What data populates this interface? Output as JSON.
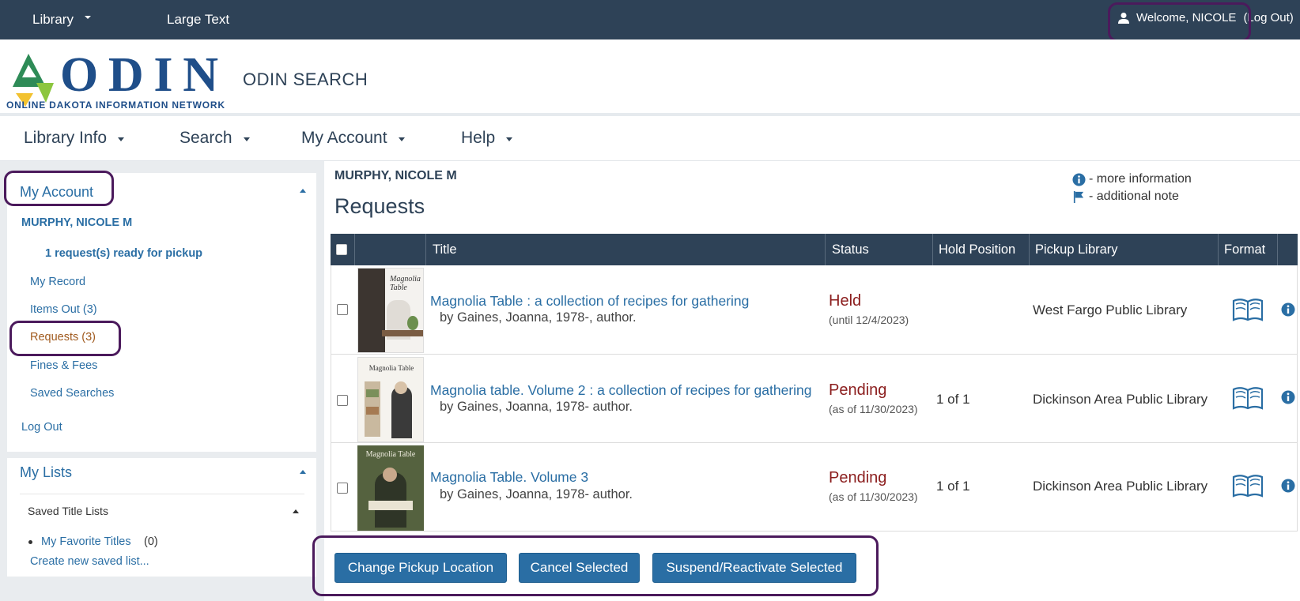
{
  "topbar": {
    "library_label": "Library",
    "large_text_label": "Large Text",
    "welcome_text": "Welcome, NICOLE",
    "logout_text": "(Log Out)"
  },
  "header": {
    "logo_text": "ODIN",
    "logo_subtitle": "ONLINE DAKOTA INFORMATION NETWORK",
    "site_title": "ODIN SEARCH"
  },
  "mainnav": {
    "items": [
      {
        "label": "Library Info"
      },
      {
        "label": "Search"
      },
      {
        "label": "My Account"
      },
      {
        "label": "Help"
      }
    ]
  },
  "sidebar": {
    "account_heading": "My Account",
    "patron_name": "MURPHY, NICOLE M",
    "pickup_notice": "1 request(s) ready for pickup",
    "links": [
      {
        "label": "My Record"
      },
      {
        "label": "Items Out (3)"
      },
      {
        "label": "Requests (3)"
      },
      {
        "label": "Fines & Fees"
      },
      {
        "label": "Saved Searches"
      }
    ],
    "logout_label": "Log Out",
    "lists_heading": "My Lists",
    "saved_title_lists_label": "Saved Title Lists",
    "favorite_list_label": "My Favorite Titles",
    "favorite_list_count": "(0)",
    "create_list_label": "Create new saved list..."
  },
  "content": {
    "patron_name": "MURPHY, NICOLE M",
    "page_title": "Requests",
    "legend_info": "- more information",
    "legend_note": "- additional note"
  },
  "table": {
    "headers": [
      "Title",
      "Status",
      "Hold Position",
      "Pickup Library",
      "Format"
    ],
    "rows": [
      {
        "title": "Magnolia Table : a collection of recipes for gathering",
        "author": "by Gaines, Joanna, 1978-, author.",
        "status": "Held",
        "status_detail": "(until 12/4/2023)",
        "hold_position": "",
        "pickup_library": "West Fargo Public Library",
        "format_icon": "book-icon",
        "cover_text": "Magnolia Table",
        "cover_color": "#f4f2ef"
      },
      {
        "title": "Magnolia table. Volume 2 : a collection of recipes for gathering",
        "author": "by Gaines, Joanna, 1978- author.",
        "status": "Pending",
        "status_detail": "(as of 11/30/2023)",
        "hold_position": "1 of 1",
        "pickup_library": "Dickinson Area Public Library",
        "format_icon": "book-icon",
        "cover_text": "Magnolia Table",
        "cover_color": "#f5f3ee"
      },
      {
        "title": "Magnolia Table. Volume 3",
        "author": "by Gaines, Joanna, 1978- author.",
        "status": "Pending",
        "status_detail": "(as of 11/30/2023)",
        "hold_position": "1 of 1",
        "pickup_library": "Dickinson Area Public Library",
        "format_icon": "book-icon",
        "cover_text": "Magnolia Table",
        "cover_color": "#55623f"
      }
    ]
  },
  "actions": {
    "change_pickup_label": "Change Pickup Location",
    "cancel_label": "Cancel Selected",
    "suspend_label": "Suspend/Reactivate Selected"
  },
  "colors": {
    "topbar_bg": "#2e4257",
    "link": "#2a6ea4",
    "status": "#8b1d1d",
    "annotation": "#4b1a5c"
  }
}
